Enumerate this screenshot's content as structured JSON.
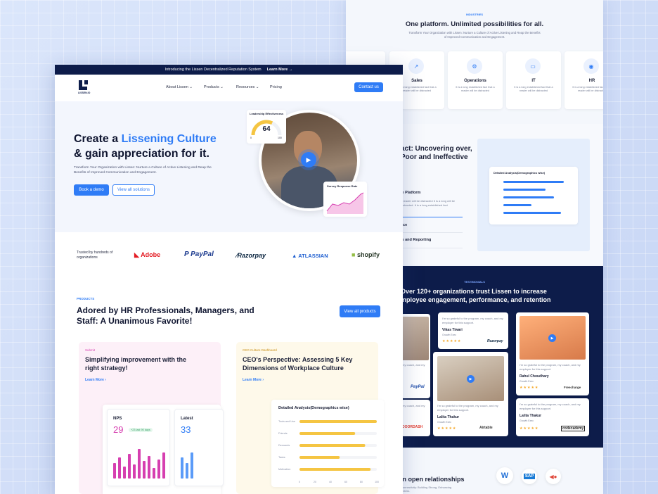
{
  "back": {
    "industries_tag": "INDUSTRIES",
    "headline": "One platform. Unlimited possibilities for all.",
    "subtext": "Transform Your Organization with Lissen: Nurture a Culture of Active Listening and Reap the Benefits of Improved Communication and Engagement.",
    "industries": [
      {
        "name": "Sales",
        "desc": "It is a long established fact that a reader will be distracted"
      },
      {
        "name": "Operations",
        "desc": "It is a long established fact that a reader will be distracted"
      },
      {
        "name": "IT",
        "desc": "It is a long established fact that a reader will be distracted"
      },
      {
        "name": "HR",
        "desc": "It is a long established fact that a reader will be distracted"
      }
    ],
    "impact_title": "act: Uncovering over, Poor and Ineffective",
    "impact_item1": "le Platform",
    "impact_desc": "a reader will be distracted It is a long will be distracted. It is a long established fact",
    "impact_item2": "ace",
    "impact_item3": "is and Reporting",
    "panel_title": "Detailed Analysis(Demographics wise)",
    "testimonials_tag": "TESTIMONIALS",
    "testimonials_title": "Over 120+ organizations trust Lissen to increase mployee engagement, performance, and retention",
    "quote": "I'm so grateful to the program, my coach, and my employer for this support.",
    "people": [
      {
        "name": "Vikas Tiwari",
        "role": "Growth Exec",
        "brand": "Razorpay"
      },
      {
        "name": "Rahul Choudhary",
        "role": "Growth Exec",
        "brand": "Freecharge"
      },
      {
        "name": "Lalita Thakur",
        "role": "Growth Exec",
        "brand": "Airtable"
      },
      {
        "name": "Lalita Thakur",
        "role": "Growth Exec",
        "brand": "codecademy"
      }
    ],
    "left_brands": [
      "PayPal",
      "DOORDASH"
    ],
    "left_quote": "my coach, and my",
    "stars": "★★★★★",
    "bottom_title": "in open relationships",
    "bottom_sub": "Connectivity: Building Strong, Enhancing Teams."
  },
  "front": {
    "announcement": "Introducing the Lissen Decentralized Reputation System",
    "announcement_link": "Learn More →",
    "logo_text": "LISSEN.IO",
    "nav": [
      "About Lissen",
      "Products",
      "Resources",
      "Pricing"
    ],
    "contact": "Contact us",
    "hero_title_a": "Create a ",
    "hero_title_b": "Lissening Culture",
    "hero_title_c": "& gain appreciation for it.",
    "hero_sub": "Transform Your Organization with Lissen: Nurture a Culture of Active Listening and Reap the Benefits of Improved Communication and Engagement.",
    "cta_demo": "Book a demo",
    "cta_solutions": "View all solutions",
    "gauge_title": "Leadership Effectiveness",
    "gauge_value": "64",
    "gauge_min": "0",
    "gauge_max": "100",
    "gauge_level": 0.64,
    "survey_title": "Survey Response Rate",
    "trusted": "Trusted by hundreds of organizations",
    "logos": [
      "Adobe",
      "PayPal",
      "Razorpay",
      "ATLASSIAN",
      "shopify"
    ],
    "products_tag": "PRODUCTS",
    "products_title": "Adored by HR Professionals, Managers, and Staff: A Unanimous Favorite!",
    "view_products": "View all products",
    "card1_tag": "Submit",
    "card1_title": "Simplifying improvement with the right strategy!",
    "card2_tag": "CEO Culture Dashboard",
    "card2_title": "CEO's Perspective: Assessing 5 Key Dimensions of Workplace Culture",
    "learn_more": "Learn More ›",
    "nps_label": "NPS",
    "nps_value": "29",
    "nps_badge": "+23 last 90 days",
    "latest_label": "Latest",
    "latest_value": "33",
    "analysis_title": "Detailed Analysis(Demographics wise)",
    "analysis_cats": [
      "Tools and Use",
      "Friends",
      "Demands",
      "Tasks",
      "Motivation"
    ],
    "analysis_values": [
      100,
      72,
      85,
      52,
      92
    ],
    "analysis_ticks": [
      "0",
      "20",
      "40",
      "60",
      "80",
      "100"
    ],
    "nps_bars": [
      0.45,
      0.6,
      0.35,
      0.7,
      0.4,
      0.85,
      0.5,
      0.65,
      0.3,
      0.55,
      0.75
    ],
    "latest_bars": [
      0.6,
      0.45,
      0.75
    ]
  },
  "colors": {
    "accent": "#2f7cf6",
    "navy": "#0d1c4a",
    "pink": "#d63fb0",
    "yellow": "#f5c542"
  }
}
